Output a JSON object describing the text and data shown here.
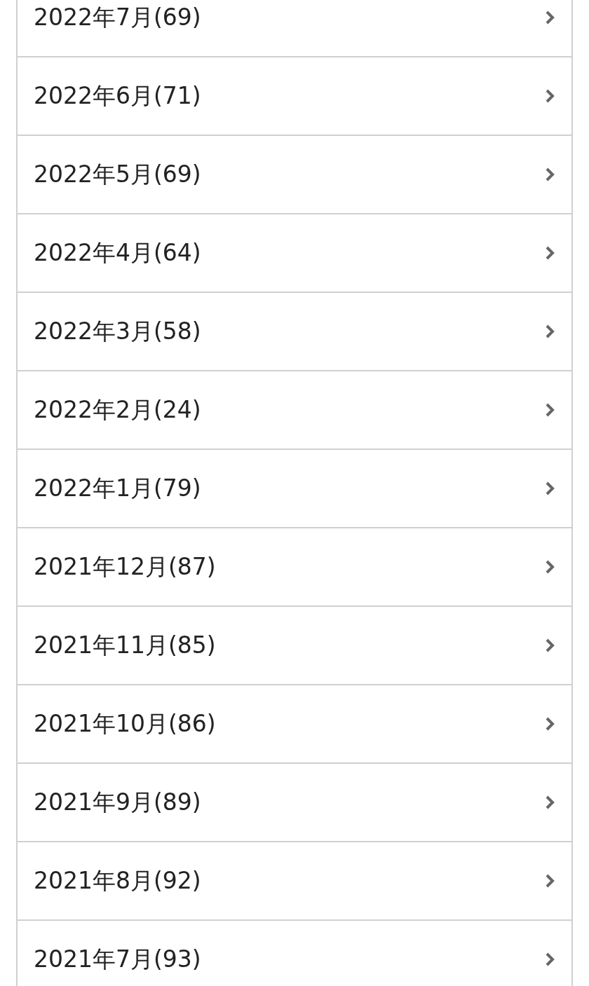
{
  "archive_items": [
    {
      "label": "2022年7月(69)"
    },
    {
      "label": "2022年6月(71)"
    },
    {
      "label": "2022年5月(69)"
    },
    {
      "label": "2022年4月(64)"
    },
    {
      "label": "2022年3月(58)"
    },
    {
      "label": "2022年2月(24)"
    },
    {
      "label": "2022年1月(79)"
    },
    {
      "label": "2021年12月(87)"
    },
    {
      "label": "2021年11月(85)"
    },
    {
      "label": "2021年10月(86)"
    },
    {
      "label": "2021年9月(89)"
    },
    {
      "label": "2021年8月(92)"
    },
    {
      "label": "2021年7月(93)"
    }
  ]
}
